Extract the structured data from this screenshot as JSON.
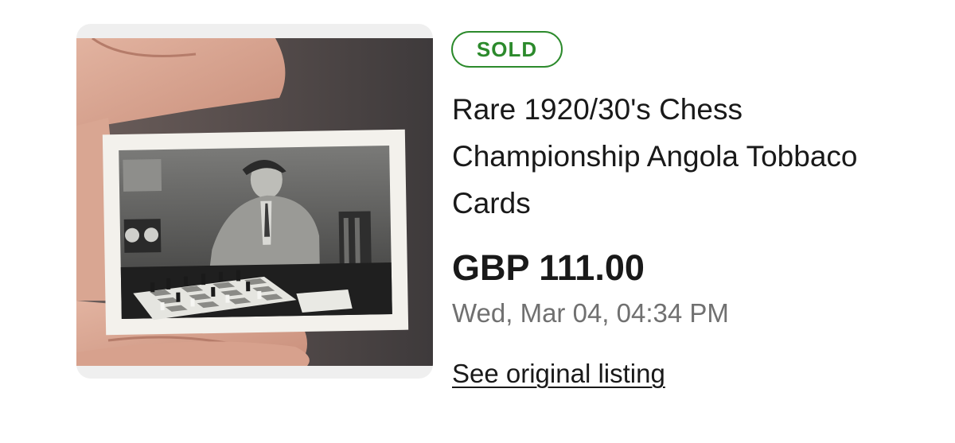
{
  "listing": {
    "status_badge": "SOLD",
    "title": "Rare 1920/30's Chess Championship Angola Tobbaco Cards",
    "price": "GBP 111.00",
    "sold_date": "Wed, Mar 04, 04:34 PM",
    "link_label": "See original listing"
  },
  "colors": {
    "sold_green": "#2c8a2c",
    "text_primary": "#191919",
    "text_secondary": "#707070",
    "image_frame_bg": "#efefef"
  }
}
